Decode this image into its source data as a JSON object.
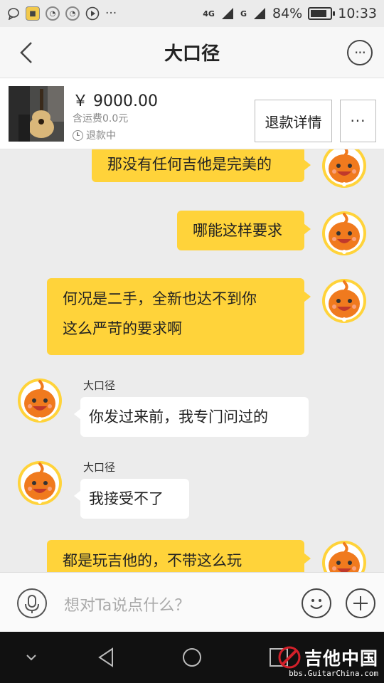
{
  "status_bar": {
    "network": "4G",
    "signal2": "G",
    "battery": "84%",
    "battery_level": 0.84,
    "time": "10:33",
    "left_icons": [
      "chat-bubble-icon",
      "app-icon-1",
      "app-icon-2",
      "app-icon-3",
      "play-icon",
      "more-dots"
    ],
    "more": "···"
  },
  "header": {
    "title": "大口径",
    "more": "···"
  },
  "product": {
    "price": "￥ 9000.00",
    "shipping": "含运费0.0元",
    "status": "退款中",
    "refund_button": "退款详情",
    "more_button": "···"
  },
  "messages": [
    {
      "side": "right",
      "text": "那没有任何吉他是完美的"
    },
    {
      "side": "right",
      "text": "哪能这样要求"
    },
    {
      "side": "right",
      "lines": [
        "何况是二手，全新也达不到你",
        "这么严苛的要求啊"
      ]
    },
    {
      "side": "left",
      "sender": "大口径",
      "text": "你发过来前，我专门问过的"
    },
    {
      "side": "left",
      "sender": "大口径",
      "text": "我接受不了"
    },
    {
      "side": "right",
      "text": "都是玩吉他的，不带这么玩"
    }
  ],
  "input": {
    "placeholder": "想对Ta说点什么？"
  },
  "watermark": {
    "main": "吉他中国",
    "sub": "bbs.GuitarChina.com"
  },
  "colors": {
    "bubble_self": "#ffd33a",
    "bubble_other": "#ffffff",
    "chat_bg": "#ececec",
    "avatar_orange": "#f07a1e",
    "avatar_ring": "#ffd33a"
  }
}
